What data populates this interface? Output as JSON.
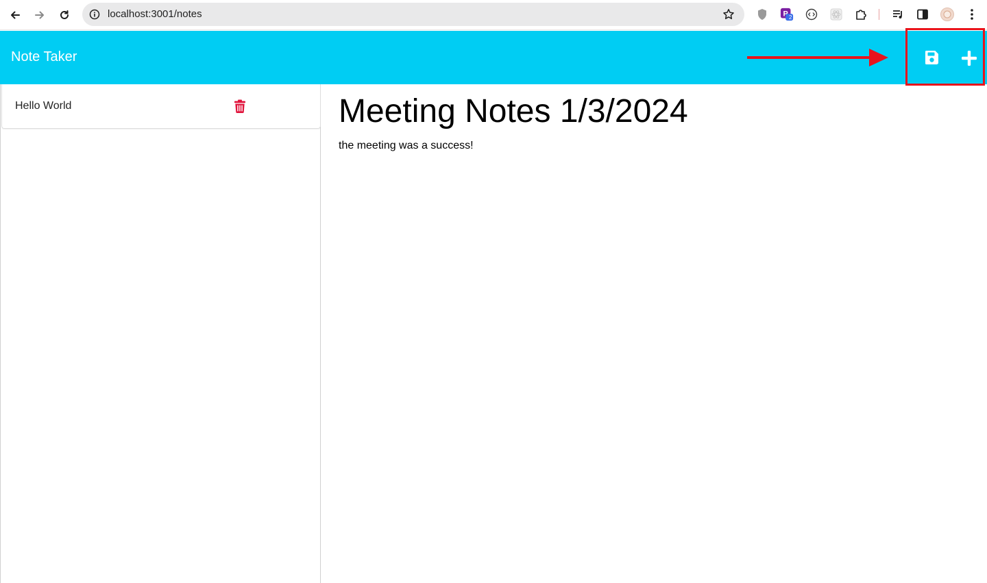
{
  "browser": {
    "url": "localhost:3001/notes",
    "extension_badge": "2",
    "icons": [
      "back-icon",
      "forward-icon",
      "reload-icon",
      "site-info-icon",
      "bookmark-star-icon",
      "shield-extension-icon",
      "extension-p-icon",
      "code-extension-icon",
      "react-devtools-icon",
      "puzzle-extensions-icon",
      "media-icon",
      "sidepanel-icon",
      "profile-avatar-icon",
      "kebab-menu-icon"
    ]
  },
  "header": {
    "title": "Note Taker",
    "background_color": "#00cdf3",
    "annotation_color": "#e8141c"
  },
  "sidebar": {
    "notes": [
      {
        "title": "Hello World"
      }
    ],
    "delete_icon_color": "#e0143c"
  },
  "main": {
    "note_title": "Meeting Notes 1/3/2024",
    "note_text": "the meeting was a success!"
  }
}
